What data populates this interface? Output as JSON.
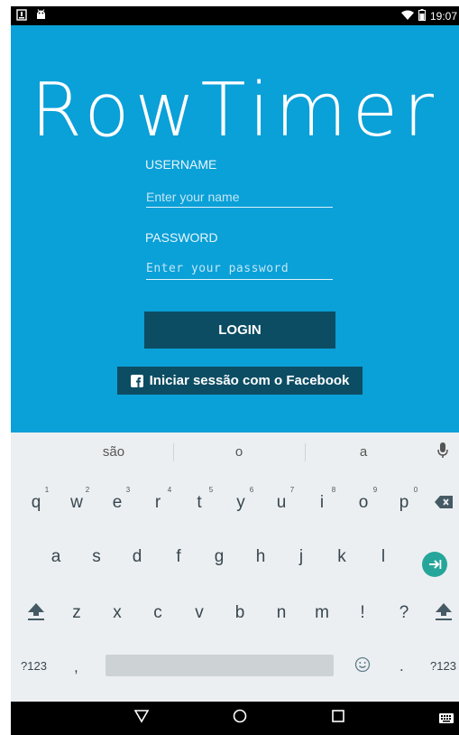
{
  "status_bar": {
    "time": "19:07"
  },
  "app": {
    "logo": "RowTimer",
    "username": {
      "label": "USERNAME",
      "placeholder": "Enter your name"
    },
    "password": {
      "label": "PASSWORD",
      "placeholder": "Enter your password"
    },
    "login_label": "LOGIN",
    "facebook_label": "Iniciar sessão com o Facebook"
  },
  "keyboard": {
    "suggestions": [
      "são",
      "o",
      "a"
    ],
    "row1": [
      {
        "key": "q",
        "hint": "1"
      },
      {
        "key": "w",
        "hint": "2"
      },
      {
        "key": "e",
        "hint": "3"
      },
      {
        "key": "r",
        "hint": "4"
      },
      {
        "key": "t",
        "hint": "5"
      },
      {
        "key": "y",
        "hint": "6"
      },
      {
        "key": "u",
        "hint": "7"
      },
      {
        "key": "i",
        "hint": "8"
      },
      {
        "key": "o",
        "hint": "9"
      },
      {
        "key": "p",
        "hint": "0"
      }
    ],
    "row2": [
      "a",
      "s",
      "d",
      "f",
      "g",
      "h",
      "j",
      "k",
      "l"
    ],
    "row3": [
      "z",
      "x",
      "c",
      "v",
      "b",
      "n",
      "m",
      "!",
      "?"
    ],
    "bottom": {
      "symbols_left": "?123",
      "comma": ",",
      "period": ".",
      "symbols_right": "?123"
    }
  },
  "icons": [
    "notification-icon",
    "android-icon",
    "wifi-icon",
    "battery-icon",
    "facebook-icon",
    "microphone-icon",
    "backspace-icon",
    "go-icon",
    "shift-icon",
    "emoji-icon",
    "back-icon",
    "home-icon",
    "recents-icon",
    "keyboard-icon"
  ],
  "colors": {
    "background": "#0aa0d8",
    "button": "#0c4d63",
    "go_key": "#26a69a"
  }
}
